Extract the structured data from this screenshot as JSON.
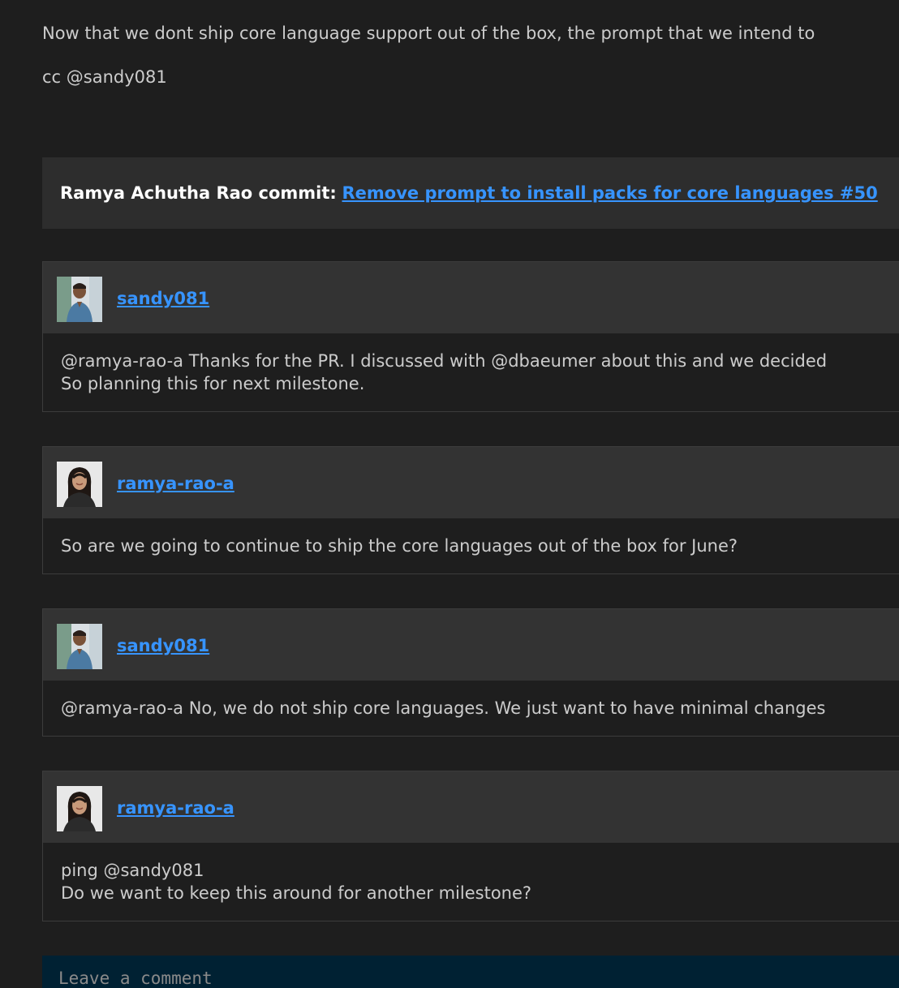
{
  "issue": {
    "body_line1": "Now that we dont ship core language support out of the box, the prompt that we intend to",
    "body_line2": "cc @sandy081"
  },
  "commit": {
    "author": "Ramya Achutha Rao commit:",
    "link_text": "Remove prompt to install packs for core languages #50"
  },
  "comments": [
    {
      "username": "sandy081",
      "avatar": "avatar-sandy081",
      "lines": [
        "@ramya-rao-a Thanks for the PR. I discussed with @dbaeumer about this and we decided",
        "So planning this for next milestone."
      ]
    },
    {
      "username": "ramya-rao-a",
      "avatar": "avatar-ramya-rao-a",
      "lines": [
        "So are we going to continue to ship the core languages out of the box for June?"
      ]
    },
    {
      "username": "sandy081",
      "avatar": "avatar-sandy081",
      "lines": [
        "@ramya-rao-a No, we do not ship core languages. We just want to have minimal changes"
      ]
    },
    {
      "username": "ramya-rao-a",
      "avatar": "avatar-ramya-rao-a",
      "lines": [
        "ping @sandy081",
        "Do we want to keep this around for another milestone?"
      ]
    }
  ],
  "comment_input": {
    "placeholder": "Leave a comment"
  },
  "colors": {
    "background": "#1e1e1e",
    "header": "#333333",
    "link": "#3794ff",
    "input": "#002133"
  }
}
